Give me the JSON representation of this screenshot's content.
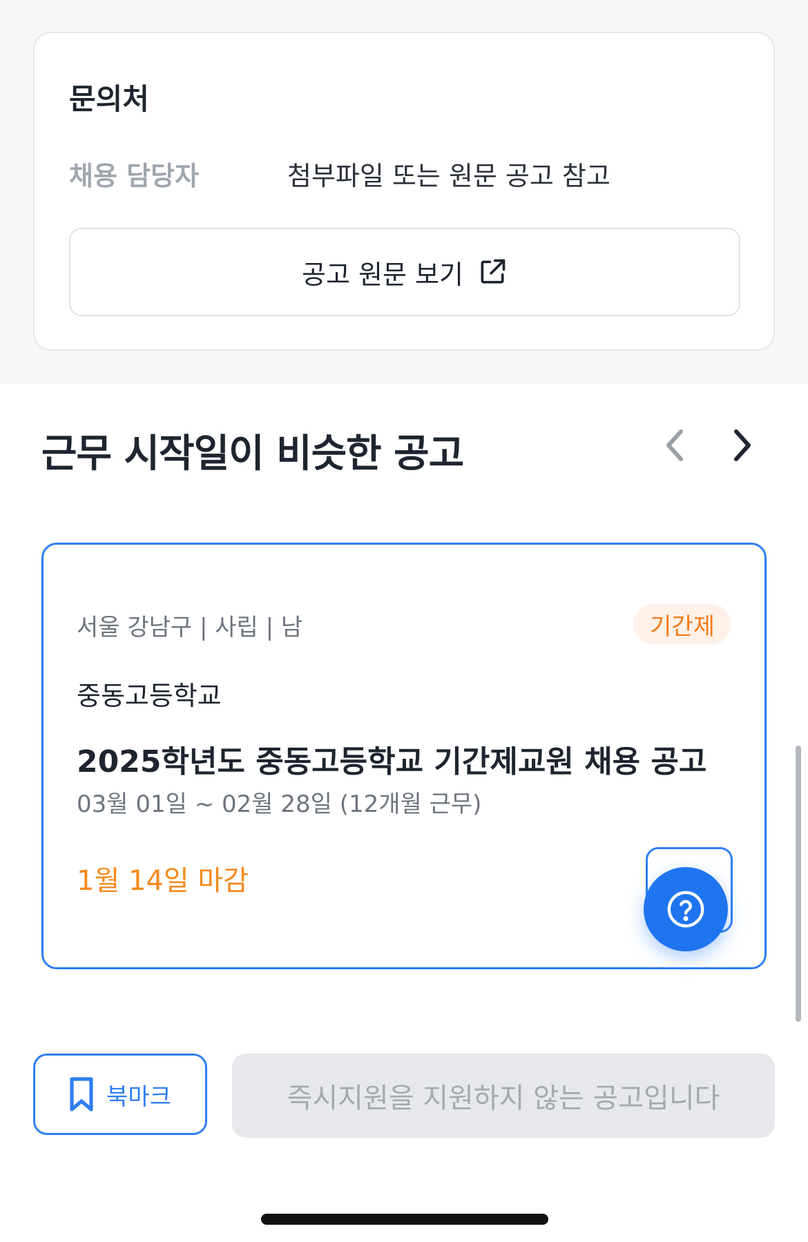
{
  "contact": {
    "title": "문의처",
    "label": "채용 담당자",
    "value": "첨부파일 또는 원문 공고 참고",
    "view_original_label": "공고 원문 보기"
  },
  "similar": {
    "title": "근무 시작일이 비슷한 공고"
  },
  "job_card": {
    "meta": "서울 강남구 | 사립 | 남",
    "badge": "기간제",
    "school": "중동고등학교",
    "title": "2025학년도 중동고등학교 기간제교원 채용 공고",
    "period": "03월 01일 ~ 02월 28일 (12개월 근무)",
    "deadline": "1월 14일 마감"
  },
  "bottom_bar": {
    "bookmark_label": "북마크",
    "apply_label": "즉시지원을 지원하지 않는 공고입니다"
  },
  "colors": {
    "accent": "#2f7ef2",
    "badge_text": "#f27c1c",
    "badge_bg": "#fff1e8",
    "deadline": "#f28a1c"
  },
  "icons": {
    "external_link": "external-link-icon",
    "prev": "chevron-left-icon",
    "next": "chevron-right-icon",
    "help": "question-circle-icon",
    "bookmark": "bookmark-icon"
  }
}
